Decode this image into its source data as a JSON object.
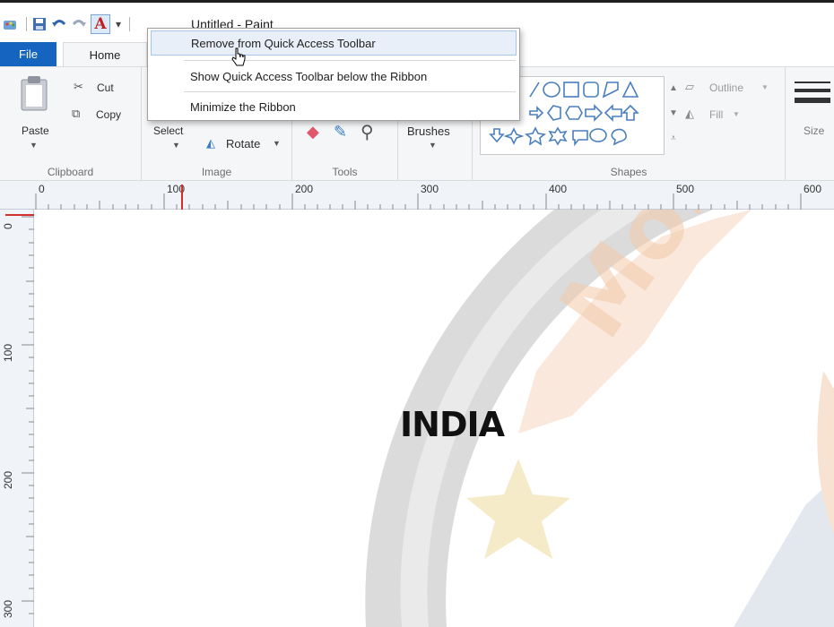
{
  "window": {
    "title": "Untitled - Paint"
  },
  "qat": {
    "icons": [
      "paint-app-icon",
      "save-icon",
      "undo-icon",
      "redo-icon",
      "font-icon",
      "customize-qat-icon"
    ],
    "font_button_glyph": "A"
  },
  "tabs": {
    "file": "File",
    "home": "Home"
  },
  "context_menu": {
    "items": [
      {
        "label": "Remove from Quick Access Toolbar",
        "highlighted": true
      },
      {
        "label": "Show Quick Access Toolbar below the Ribbon"
      },
      {
        "label": "Minimize the Ribbon"
      }
    ]
  },
  "ribbon": {
    "clipboard": {
      "paste": "Paste",
      "cut": "Cut",
      "copy": "Copy",
      "label": "Clipboard"
    },
    "image": {
      "select": "Select",
      "rotate": "Rotate",
      "label": "Image"
    },
    "tools": {
      "label": "Tools"
    },
    "brushes": {
      "label": "Brushes"
    },
    "shapes": {
      "label": "Shapes",
      "outline": "Outline",
      "fill": "Fill"
    },
    "size": {
      "label": "Size"
    }
  },
  "ruler": {
    "horizontal": [
      "0",
      "100",
      "200",
      "300",
      "400",
      "500",
      "600"
    ],
    "vertical": [
      "0",
      "100",
      "200",
      "300"
    ]
  },
  "canvas": {
    "text": "INDIA",
    "watermark_text": "Mobi"
  },
  "colors": {
    "file_tab": "#1565c0",
    "menu_highlight": "#e8eff8",
    "ruler_marker": "#d32f2f"
  }
}
